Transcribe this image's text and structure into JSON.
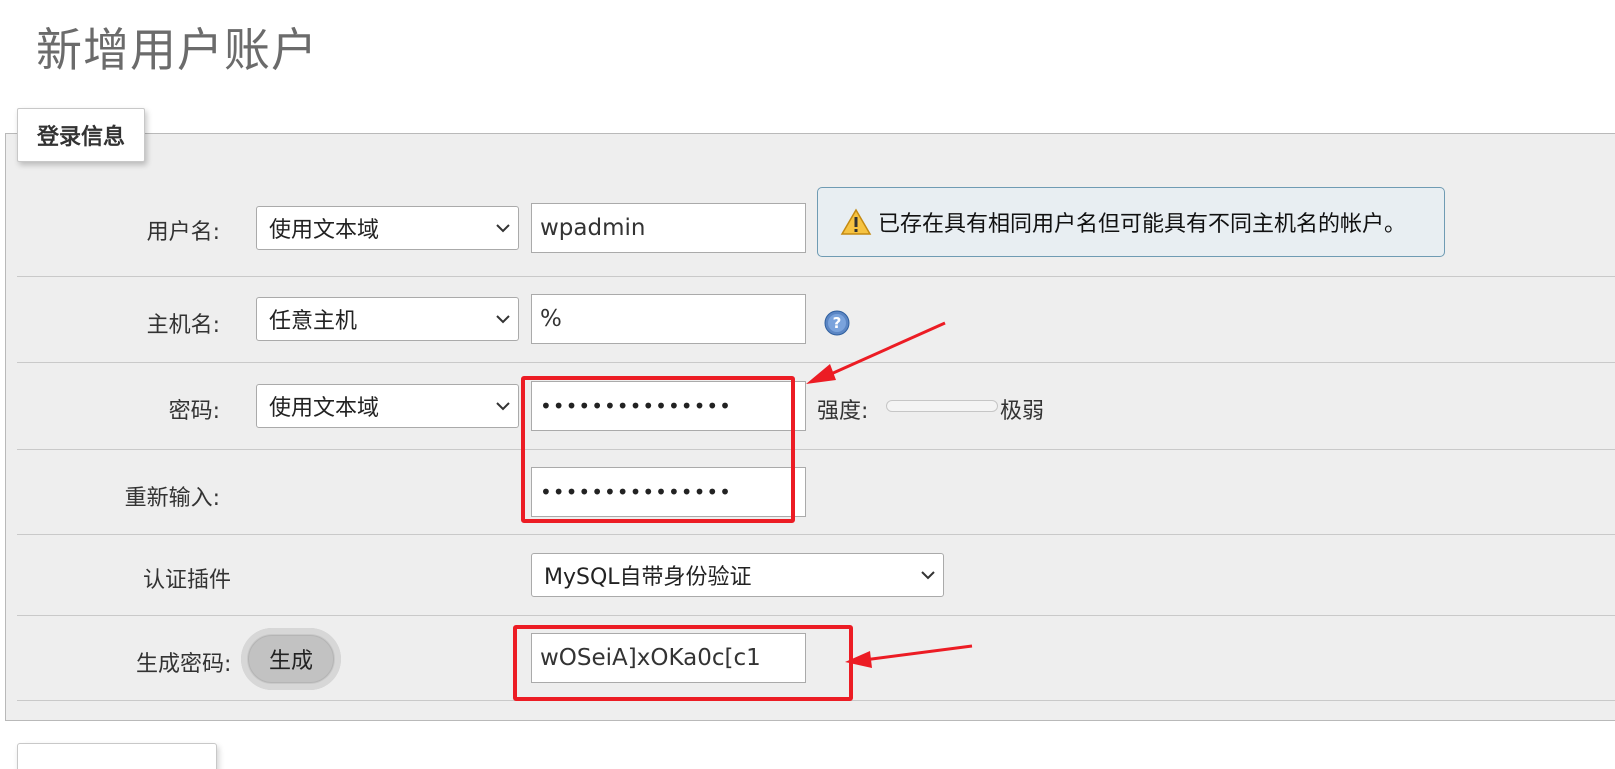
{
  "page_title": "新增用户账户",
  "legend": "登录信息",
  "rows": {
    "username": {
      "label": "用户名:",
      "select_value": "使用文本域",
      "input_value": "wpadmin"
    },
    "hostname": {
      "label": "主机名:",
      "select_value": "任意主机",
      "input_value": "%"
    },
    "password": {
      "label": "密码:",
      "select_value": "使用文本域",
      "input_value": "•••••••••••••••",
      "strength_label": "强度:",
      "strength_value": "极弱"
    },
    "reenter": {
      "label": "重新输入:",
      "input_value": "•••••••••••••••"
    },
    "auth_plugin": {
      "label": "认证插件",
      "select_value": "MySQL自带身份验证"
    },
    "generate": {
      "label": "生成密码:",
      "button_label": "生成",
      "input_value": "wOSeiA]xOKa0c[c1"
    }
  },
  "notice": {
    "icon": "warning-icon",
    "text": "已存在具有相同用户名但可能具有不同主机名的帐户。"
  },
  "colors": {
    "annotation": "#ec1c24",
    "notice_border": "#6f9bb3",
    "fieldset_bg": "#eeeeee"
  }
}
